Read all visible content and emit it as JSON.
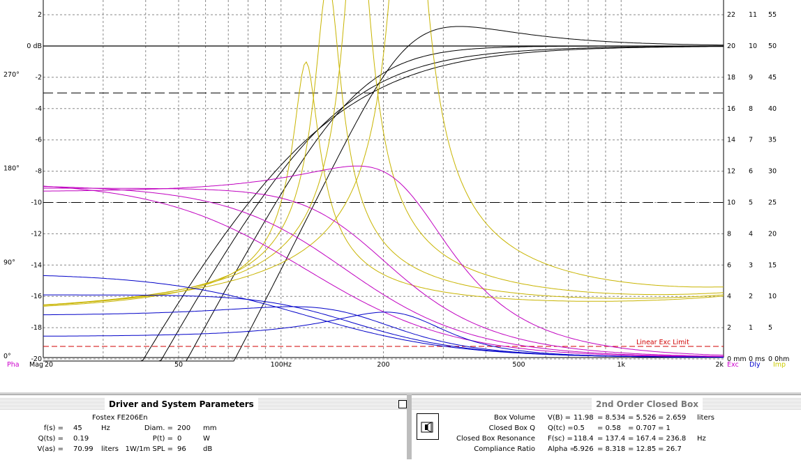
{
  "plot": {
    "left_labels": [
      "2",
      "0 dB",
      "-2",
      "-4",
      "-6",
      "-8",
      "-10",
      "-12",
      "-14",
      "-16",
      "-18",
      "-20"
    ],
    "phase_labels": [
      "270°",
      "180°",
      "90°",
      "0°"
    ],
    "right_col1": [
      "22",
      "20",
      "18",
      "16",
      "14",
      "12",
      "10",
      "8",
      "6",
      "4",
      "2",
      "0 mm"
    ],
    "right_col2": [
      "11",
      "10",
      "9",
      "8",
      "7",
      "6",
      "5",
      "4",
      "3",
      "2",
      "1",
      "0 ms"
    ],
    "right_col3": [
      "55",
      "50",
      "45",
      "40",
      "35",
      "30",
      "25",
      "20",
      "15",
      "10",
      "5",
      "0 0hm"
    ],
    "x_labels": [
      {
        "f": 20,
        "t": "20"
      },
      {
        "f": 50,
        "t": "50"
      },
      {
        "f": 100,
        "t": "100Hz"
      },
      {
        "f": 200,
        "t": "200"
      },
      {
        "f": 500,
        "t": "500"
      },
      {
        "f": 1000,
        "t": "1k"
      },
      {
        "f": 2000,
        "t": "2k"
      }
    ],
    "pha_label": "Pha",
    "mag_label": "Mag",
    "legend": [
      {
        "text": "Exc",
        "color": "#cc00cc"
      },
      {
        "text": "Dly",
        "color": "#0000cc"
      },
      {
        "text": "Imp",
        "color": "#cccc00"
      }
    ],
    "linear_exc_limit": "Linear Exc Limit",
    "colors": {
      "mag": "#000000",
      "imp": "#c8b400",
      "exc": "#c000c0",
      "dly": "#0000c8",
      "limit": "#d00000"
    }
  },
  "left_panel": {
    "title": "Driver and System Parameters",
    "driver": "Fostex  FE206En",
    "rows": [
      {
        "k": "f(s) =",
        "v": "45",
        "u": "Hz",
        "k2": "Diam. =",
        "v2": "200",
        "u2": "mm"
      },
      {
        "k": "Q(ts) =",
        "v": "0.19",
        "u": "",
        "k2": "P(t) =",
        "v2": "0",
        "u2": "W"
      },
      {
        "k": "V(as) =",
        "v": "70.99",
        "u": "liters",
        "k2": "1W/1m SPL =",
        "v2": "96",
        "u2": "dB"
      }
    ]
  },
  "right_panel": {
    "title": "2nd Order Closed Box",
    "rows": [
      {
        "name": "Box Volume",
        "sym": "V(B) =",
        "vals": [
          "11.98",
          "= 8.534",
          "= 5.526",
          "= 2.659"
        ],
        "unit": "liters"
      },
      {
        "name": "Closed Box Q",
        "sym": "Q(tc) =",
        "vals": [
          "0.5",
          "= 0.58",
          "= 0.707",
          "= 1"
        ],
        "unit": ""
      },
      {
        "name": "Closed Box Resonance",
        "sym": "F(sc) =",
        "vals": [
          "118.4",
          "= 137.4",
          "= 167.4",
          "= 236.8"
        ],
        "unit": "Hz"
      },
      {
        "name": "Compliance Ratio",
        "sym": "Alpha =",
        "vals": [
          "5.926",
          "= 8.318",
          "= 12.85",
          "= 26.7"
        ],
        "unit": ""
      }
    ]
  }
}
